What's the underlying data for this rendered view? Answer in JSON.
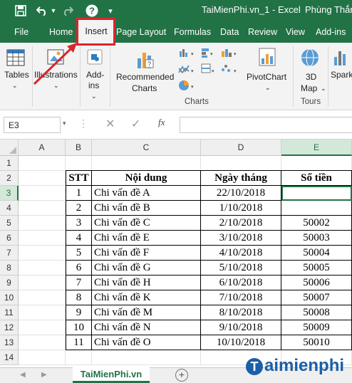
{
  "titlebar": {
    "doc_title": "TaiMienPhi.vn_1  -  Excel",
    "user": "Phùng Thắn"
  },
  "tabs": [
    "File",
    "Home",
    "Insert",
    "Page Layout",
    "Formulas",
    "Data",
    "Review",
    "View",
    "Add-ins"
  ],
  "ribbon": {
    "tables": "Tables",
    "illustrations": "Illustrations",
    "addins_1": "Add-",
    "addins_2": "ins",
    "rec_charts_1": "Recommended",
    "rec_charts_2": "Charts",
    "charts_group": "Charts",
    "pivotchart": "PivotChart",
    "map_1": "3D",
    "map_2": "Map",
    "tours_group": "Tours",
    "spark": "Spark"
  },
  "formula_bar": {
    "name_box": "E3",
    "fx": "fx",
    "value": ""
  },
  "columns": [
    "A",
    "B",
    "C",
    "D",
    "E"
  ],
  "rows": [
    "1",
    "2",
    "3",
    "4",
    "5",
    "6",
    "7",
    "8",
    "9",
    "10",
    "11",
    "12",
    "13",
    "14"
  ],
  "table": {
    "headers": [
      "STT",
      "Nội dung",
      "Ngày tháng",
      "Số tiền"
    ],
    "rows": [
      [
        "1",
        "Chi vấn đề A",
        "22/10/2018",
        ""
      ],
      [
        "2",
        "Chi vấn đề B",
        "1/10/2018",
        ""
      ],
      [
        "3",
        "Chi vấn đề C",
        "2/10/2018",
        "50002"
      ],
      [
        "4",
        "Chi vấn đề E",
        "3/10/2018",
        "50003"
      ],
      [
        "5",
        "Chi vấn đề F",
        "4/10/2018",
        "50004"
      ],
      [
        "6",
        "Chi vấn đề G",
        "5/10/2018",
        "50005"
      ],
      [
        "7",
        "Chi vấn đề H",
        "6/10/2018",
        "50006"
      ],
      [
        "8",
        "Chi vấn đề K",
        "7/10/2018",
        "50007"
      ],
      [
        "9",
        "Chi vấn đề M",
        "8/10/2018",
        "50008"
      ],
      [
        "10",
        "Chi vấn đề N",
        "9/10/2018",
        "50009"
      ],
      [
        "11",
        "Chi vấn đề O",
        "10/10/2018",
        "50010"
      ]
    ]
  },
  "sheet_tab": "TaiMienPhi.vn",
  "watermark": "aimienphi",
  "watermark_t": "T",
  "colors": {
    "excel_green": "#217346",
    "highlight_red": "#d9262c"
  }
}
